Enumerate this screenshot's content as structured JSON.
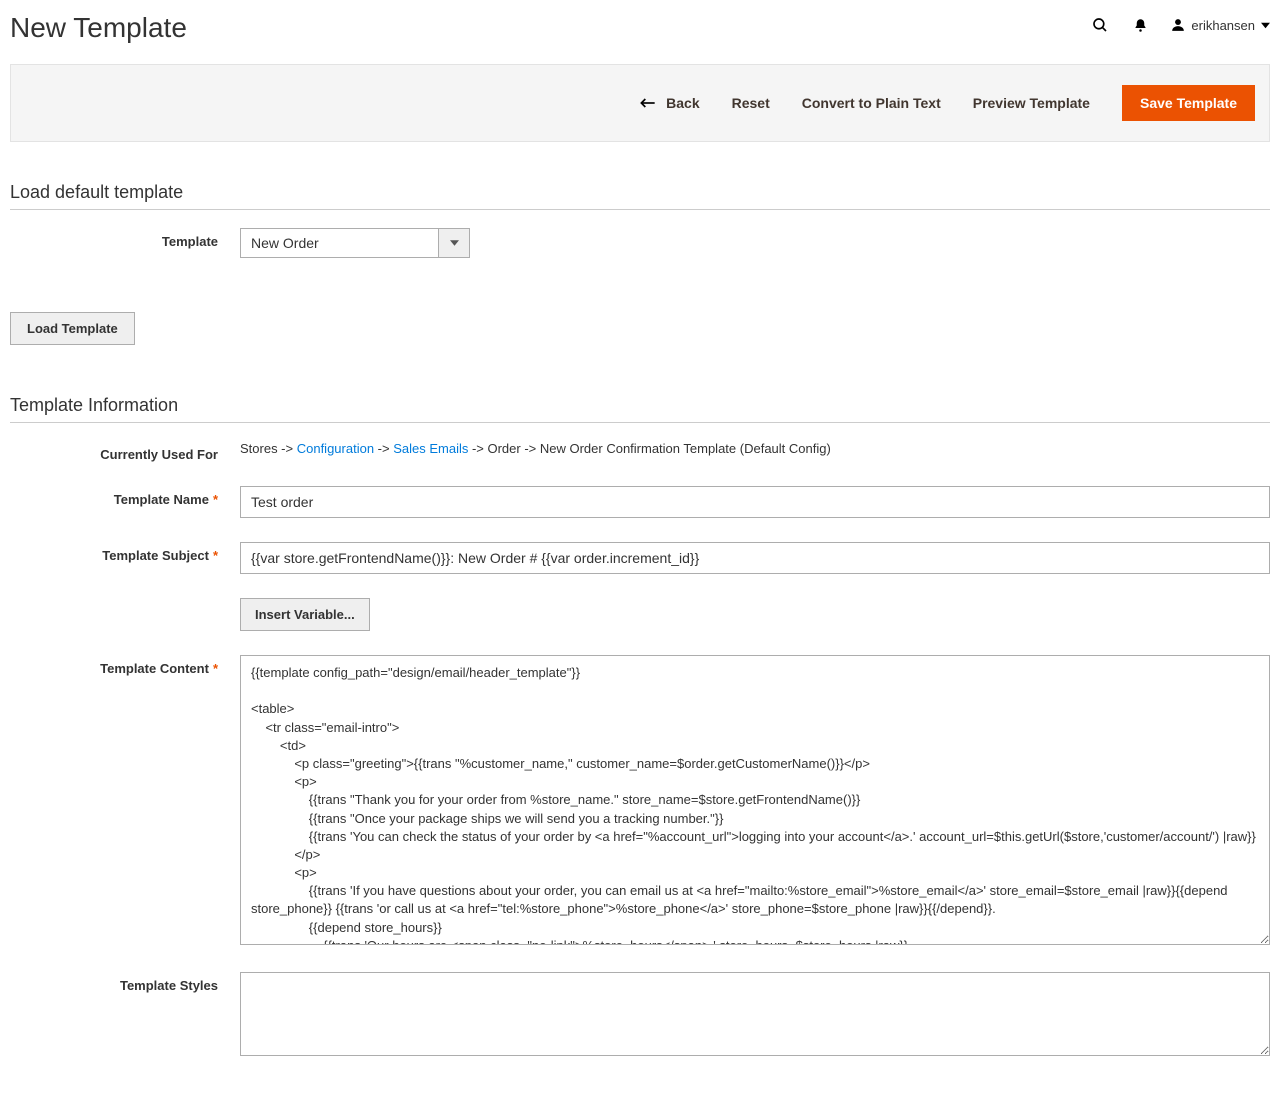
{
  "header": {
    "page_title": "New Template",
    "username": "erikhansen"
  },
  "toolbar": {
    "back": "Back",
    "reset": "Reset",
    "convert": "Convert to Plain Text",
    "preview": "Preview Template",
    "save": "Save Template"
  },
  "load_section": {
    "title": "Load default template",
    "template_label": "Template",
    "template_selected": "New Order",
    "load_btn": "Load Template"
  },
  "info_section": {
    "title": "Template Information",
    "used_for_label": "Currently Used For",
    "used_for_path": {
      "p1": "Stores -> ",
      "link1": "Configuration",
      "p2": " -> ",
      "link2": "Sales Emails",
      "p3": " -> Order -> New Order Confirmation Template  (Default Config)"
    },
    "name_label": "Template Name",
    "name_value": "Test order",
    "subject_label": "Template Subject",
    "subject_value": "{{var store.getFrontendName()}}: New Order # {{var order.increment_id}}",
    "insert_var_btn": "Insert Variable...",
    "content_label": "Template Content",
    "content_value": "{{template config_path=\"design/email/header_template\"}}\n\n<table>\n    <tr class=\"email-intro\">\n        <td>\n            <p class=\"greeting\">{{trans \"%customer_name,\" customer_name=$order.getCustomerName()}}</p>\n            <p>\n                {{trans \"Thank you for your order from %store_name.\" store_name=$store.getFrontendName()}}\n                {{trans \"Once your package ships we will send you a tracking number.\"}}\n                {{trans 'You can check the status of your order by <a href=\"%account_url\">logging into your account</a>.' account_url=$this.getUrl($store,'customer/account/') |raw}}\n            </p>\n            <p>\n                {{trans 'If you have questions about your order, you can email us at <a href=\"mailto:%store_email\">%store_email</a>' store_email=$store_email |raw}}{{depend store_phone}} {{trans 'or call us at <a href=\"tel:%store_phone\">%store_phone</a>' store_phone=$store_phone |raw}}{{/depend}}.\n                {{depend store_hours}}\n                    {{trans 'Our hours are <span class=\"no-link\">%store_hours</span>.' store_hours=$store_hours |raw}}\n                {{/depend}}\n            </p>\n        </td>",
    "styles_label": "Template Styles",
    "styles_value": ""
  }
}
